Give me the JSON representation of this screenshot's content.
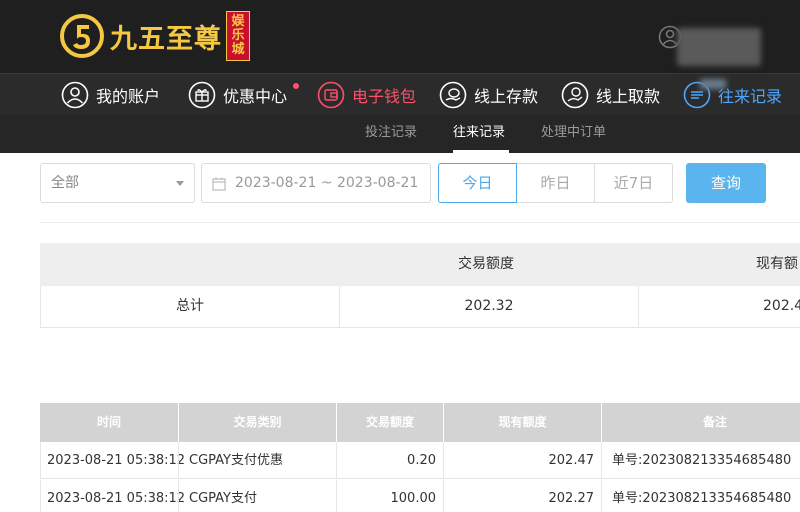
{
  "header": {
    "logo_text": "九五至尊",
    "logo_badge": [
      "娱",
      "乐",
      "城"
    ],
    "colors": {
      "header_bg": "#1f1f1f",
      "logo_gold": "#f5c843",
      "badge_red": "#c8102e"
    }
  },
  "mainnav": {
    "items": [
      {
        "label": "我的账户",
        "icon": "user-circle-icon"
      },
      {
        "label": "优惠中心",
        "icon": "gift-icon",
        "has_dot": true
      },
      {
        "label": "电子钱包",
        "icon": "wallet-icon",
        "state": "highlight"
      },
      {
        "label": "线上存款",
        "icon": "deposit-icon"
      },
      {
        "label": "线上取款",
        "icon": "withdraw-icon"
      },
      {
        "label": "往来记录",
        "icon": "records-icon",
        "state": "active"
      }
    ]
  },
  "subnav": {
    "items": [
      {
        "label": "投注记录"
      },
      {
        "label": "往来记录",
        "active": true
      },
      {
        "label": "处理中订单"
      }
    ]
  },
  "filters": {
    "type_select": "全部",
    "date_range": "2023-08-21 ~ 2023-08-21",
    "quick_ranges": [
      "今日",
      "昨日",
      "近7日"
    ],
    "active_range": "今日",
    "query_label": "查询"
  },
  "summary": {
    "headers": [
      "",
      "交易额度",
      "现有额"
    ],
    "row": {
      "label": "总计",
      "amount": "202.32",
      "balance": "202.4"
    }
  },
  "detail": {
    "headers": [
      "时间",
      "交易类别",
      "交易额度",
      "现有额度",
      "备注"
    ],
    "rows": [
      {
        "time": "2023-08-21 05:38:12",
        "category": "CGPAY支付优惠",
        "amount": "0.20",
        "balance": "202.47",
        "note": "单号:202308213354685480"
      },
      {
        "time": "2023-08-21 05:38:12",
        "category": "CGPAY支付",
        "amount": "100.00",
        "balance": "202.27",
        "note": "单号:202308213354685480"
      }
    ]
  }
}
